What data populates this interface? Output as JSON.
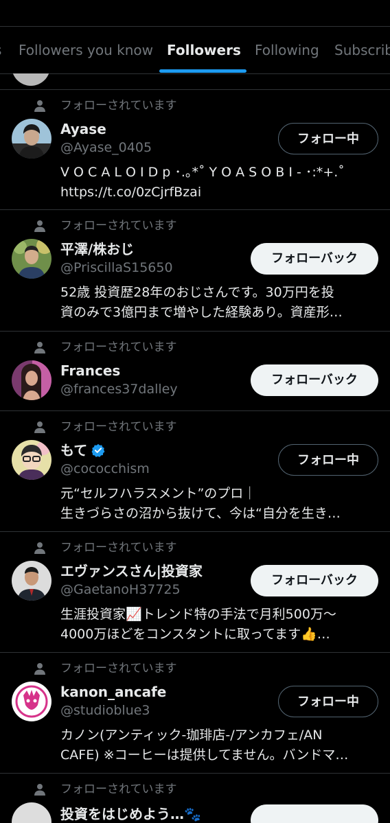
{
  "tabs": [
    {
      "label": "s"
    },
    {
      "label": "Followers you know"
    },
    {
      "label": "Followers"
    },
    {
      "label": "Following"
    },
    {
      "label": "Subscrib"
    }
  ],
  "colors": {
    "accent": "#1d9bf0",
    "background": "#000000",
    "muted": "#71767b",
    "verified": "#1d9bf0"
  },
  "context_label": "フォローされています",
  "users": [
    {
      "name": "Ayase",
      "handle": "@Ayase_0405",
      "bio": [
        "V O C A L O I D p ･.｡*˚ Y O A S O B I - ･:*+.˚",
        "https://t.co/0zCjrfBzai"
      ],
      "button": "フォロー中",
      "button_state": "following",
      "avatar_icon": "avatar-photo-icon",
      "verified": false
    },
    {
      "name": "平澤/株おじ",
      "handle": "@PriscillaS15650",
      "bio": [
        "52歳 投資歴28年のおじさんです。30万円を投",
        "資のみで3億円まで増やした経験あり。資産形…"
      ],
      "button": "フォローバック",
      "button_state": "followback",
      "avatar_icon": "avatar-photo-icon",
      "verified": false
    },
    {
      "name": "Frances",
      "handle": "@frances37dalley",
      "bio": [],
      "button": "フォローバック",
      "button_state": "followback",
      "avatar_icon": "avatar-photo-icon",
      "verified": false
    },
    {
      "name": "もて",
      "handle": "@cococchism",
      "bio": [
        "元“セルフハラスメント”のプロ｜",
        "生きづらさの沼から抜けて、今は“自分を生き…"
      ],
      "button": "フォロー中",
      "button_state": "following",
      "avatar_icon": "avatar-illustration-icon",
      "verified": true
    },
    {
      "name": "エヴァンスさん|投資家",
      "handle": "@GaetanoH37725",
      "bio": [
        "生涯投資家📈トレンド特の手法で月利500万〜",
        "4000万ほどをコンスタントに取ってます👍…"
      ],
      "button": "フォローバック",
      "button_state": "followback",
      "avatar_icon": "avatar-photo-icon",
      "verified": false
    },
    {
      "name": "kanon_ancafe",
      "handle": "@studioblue3",
      "bio": [
        "カノン(アンティック-珈琲店-/アンカフェ/AN",
        "CAFE) ※コーヒーは提供してません。バンドマ…"
      ],
      "button": "フォロー中",
      "button_state": "following",
      "avatar_icon": "avatar-logo-icon",
      "verified": false
    }
  ],
  "last_row": {
    "name": "投資をはじめよう…🐾"
  }
}
